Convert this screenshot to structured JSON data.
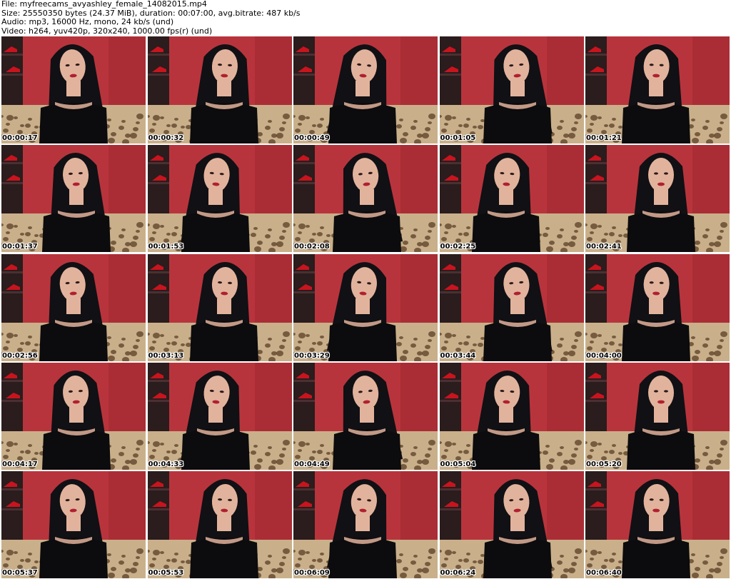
{
  "header": {
    "file_line": "File: myfreecams_avyashley_female_14082015.mp4",
    "size_line": "Size: 25550350 bytes (24.37 MiB), duration: 00:07:00, avg.bitrate: 487 kb/s",
    "audio_line": "Audio: mp3, 16000 Hz, mono, 24 kb/s (und)",
    "video_line": "Video: h264, yuv420p, 320x240, 1000.00 fps(r) (und)"
  },
  "thumbnails": [
    {
      "timestamp": "00:00:17"
    },
    {
      "timestamp": "00:00:32"
    },
    {
      "timestamp": "00:00:49"
    },
    {
      "timestamp": "00:01:05"
    },
    {
      "timestamp": "00:01:21"
    },
    {
      "timestamp": "00:01:37"
    },
    {
      "timestamp": "00:01:53"
    },
    {
      "timestamp": "00:02:08"
    },
    {
      "timestamp": "00:02:25"
    },
    {
      "timestamp": "00:02:41"
    },
    {
      "timestamp": "00:02:56"
    },
    {
      "timestamp": "00:03:13"
    },
    {
      "timestamp": "00:03:29"
    },
    {
      "timestamp": "00:03:44"
    },
    {
      "timestamp": "00:04:00"
    },
    {
      "timestamp": "00:04:17"
    },
    {
      "timestamp": "00:04:33"
    },
    {
      "timestamp": "00:04:49"
    },
    {
      "timestamp": "00:05:04"
    },
    {
      "timestamp": "00:05:20"
    },
    {
      "timestamp": "00:05:37"
    },
    {
      "timestamp": "00:05:53"
    },
    {
      "timestamp": "00:06:09"
    },
    {
      "timestamp": "00:06:24"
    },
    {
      "timestamp": "00:06:40"
    }
  ],
  "colors": {
    "wall": "#b8343c",
    "wall_dark": "#8e2128",
    "couch": "#c9b08a",
    "couch_spot": "#5a3f26",
    "hair": "#111014",
    "skin": "#e2b39c",
    "top": "#0c0b0d",
    "shelf": "#2b1c1d",
    "shoe": "#c8141e"
  }
}
